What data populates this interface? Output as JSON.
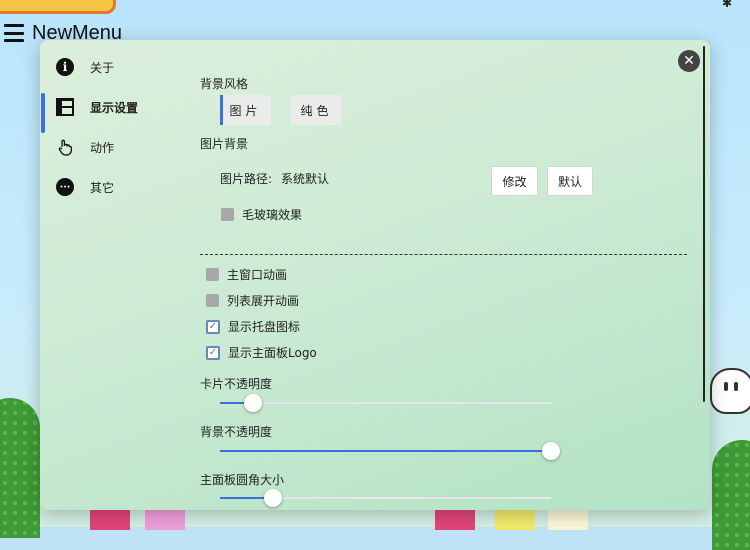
{
  "app": {
    "title": "NewMenu"
  },
  "sidebar": {
    "items": [
      {
        "label": "关于",
        "icon": "info-icon",
        "active": false
      },
      {
        "label": "显示设置",
        "icon": "layout-icon",
        "active": true
      },
      {
        "label": "动作",
        "icon": "hand-pointer-icon",
        "active": false
      },
      {
        "label": "其它",
        "icon": "more-icon",
        "active": false
      }
    ]
  },
  "content": {
    "bg_style": {
      "title": "背景风格",
      "options": [
        "图片",
        "纯色"
      ],
      "selected": "图片"
    },
    "image_bg": {
      "title": "图片背景",
      "path_label": "图片路径:",
      "path_value": "系统默认",
      "modify_label": "修改",
      "default_label": "默认",
      "frosted": {
        "label": "毛玻璃效果",
        "checked": false
      }
    },
    "toggles": [
      {
        "label": "主窗口动画",
        "checked": false
      },
      {
        "label": "列表展开动画",
        "checked": false
      },
      {
        "label": "显示托盘图标",
        "checked": true
      },
      {
        "label": "显示主面板Logo",
        "checked": true
      }
    ],
    "sliders": [
      {
        "label": "卡片不透明度",
        "value": 0.1
      },
      {
        "label": "背景不透明度",
        "value": 1.0
      },
      {
        "label": "主面板圆角大小",
        "value": 0.16
      }
    ]
  },
  "colors": {
    "accent": "#3a6fe0"
  }
}
